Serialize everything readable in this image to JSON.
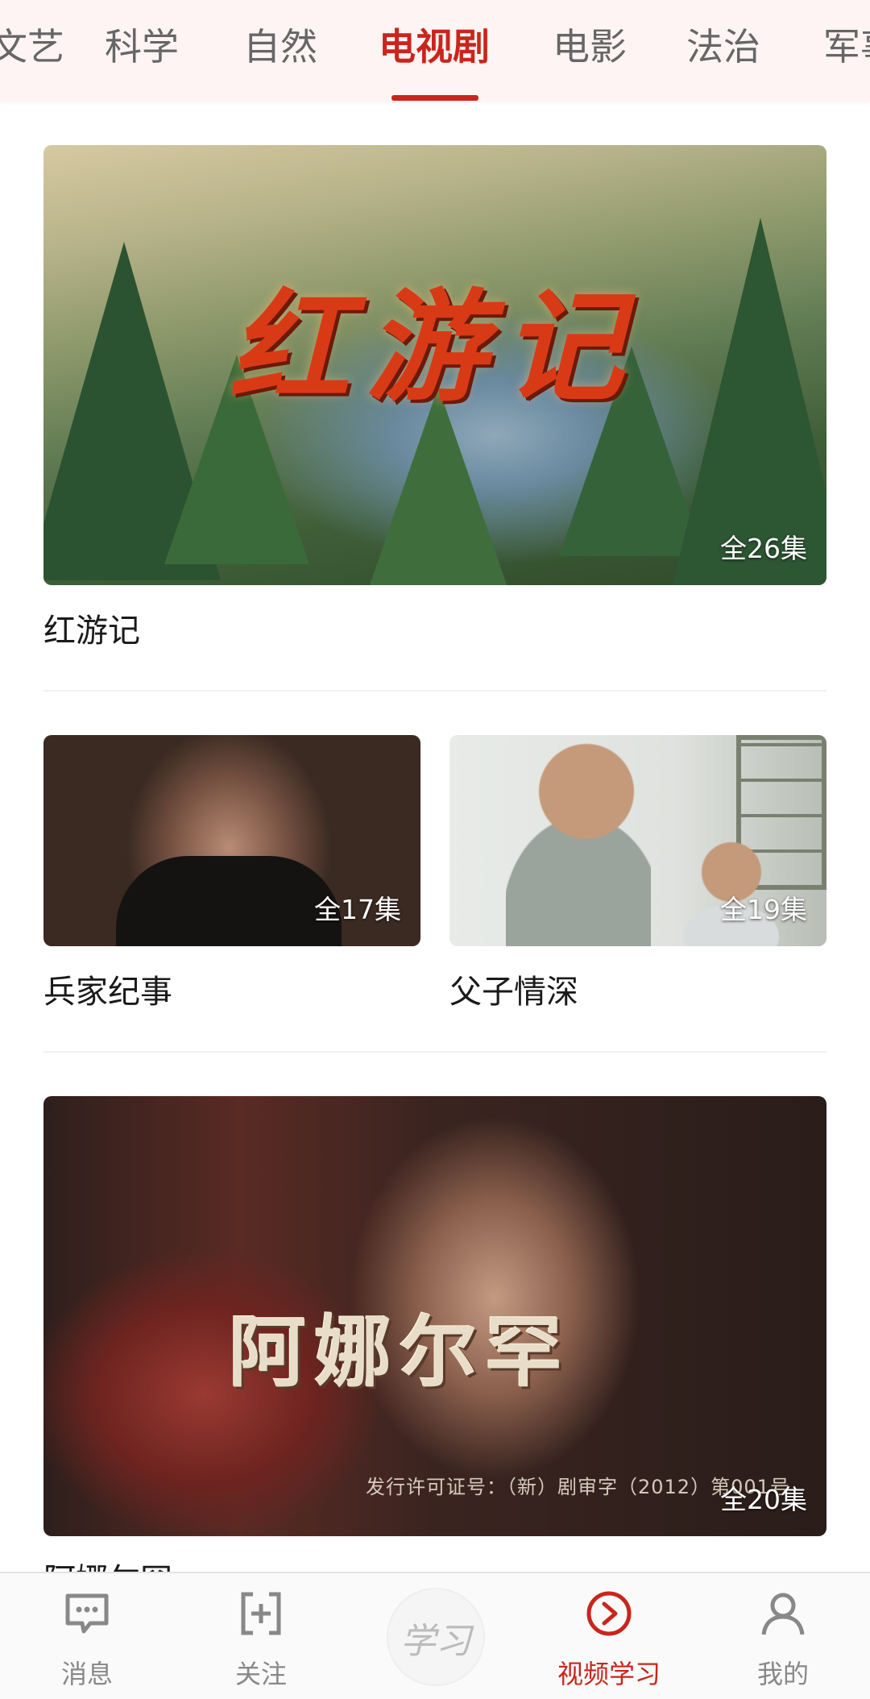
{
  "tabs": [
    "文艺",
    "科学",
    "自然",
    "电视剧",
    "电影",
    "法治",
    "军事"
  ],
  "active_tab": "电视剧",
  "items": [
    {
      "title": "红游记",
      "badge": "全26集",
      "art_text": "红游记"
    },
    {
      "title": "兵家纪事",
      "badge": "全17集"
    },
    {
      "title": "父子情深",
      "badge": "全19集"
    },
    {
      "title": "阿娜尔罕",
      "badge": "全20集",
      "art_text": "阿娜尔罕",
      "art_subtext": "发行许可证号：（新）剧审字（2012）第001号"
    }
  ],
  "bottom_nav": [
    {
      "label": "消息",
      "icon": "message-icon"
    },
    {
      "label": "关注",
      "icon": "follow-icon"
    },
    {
      "label": "学习",
      "icon": "xuexi-logo-icon"
    },
    {
      "label": "视频学习",
      "icon": "video-play-icon",
      "active": true
    },
    {
      "label": "我的",
      "icon": "profile-icon"
    }
  ],
  "colors": {
    "accent": "#c8261d",
    "tab_bg": "#fdf4f3",
    "muted": "#888888"
  }
}
